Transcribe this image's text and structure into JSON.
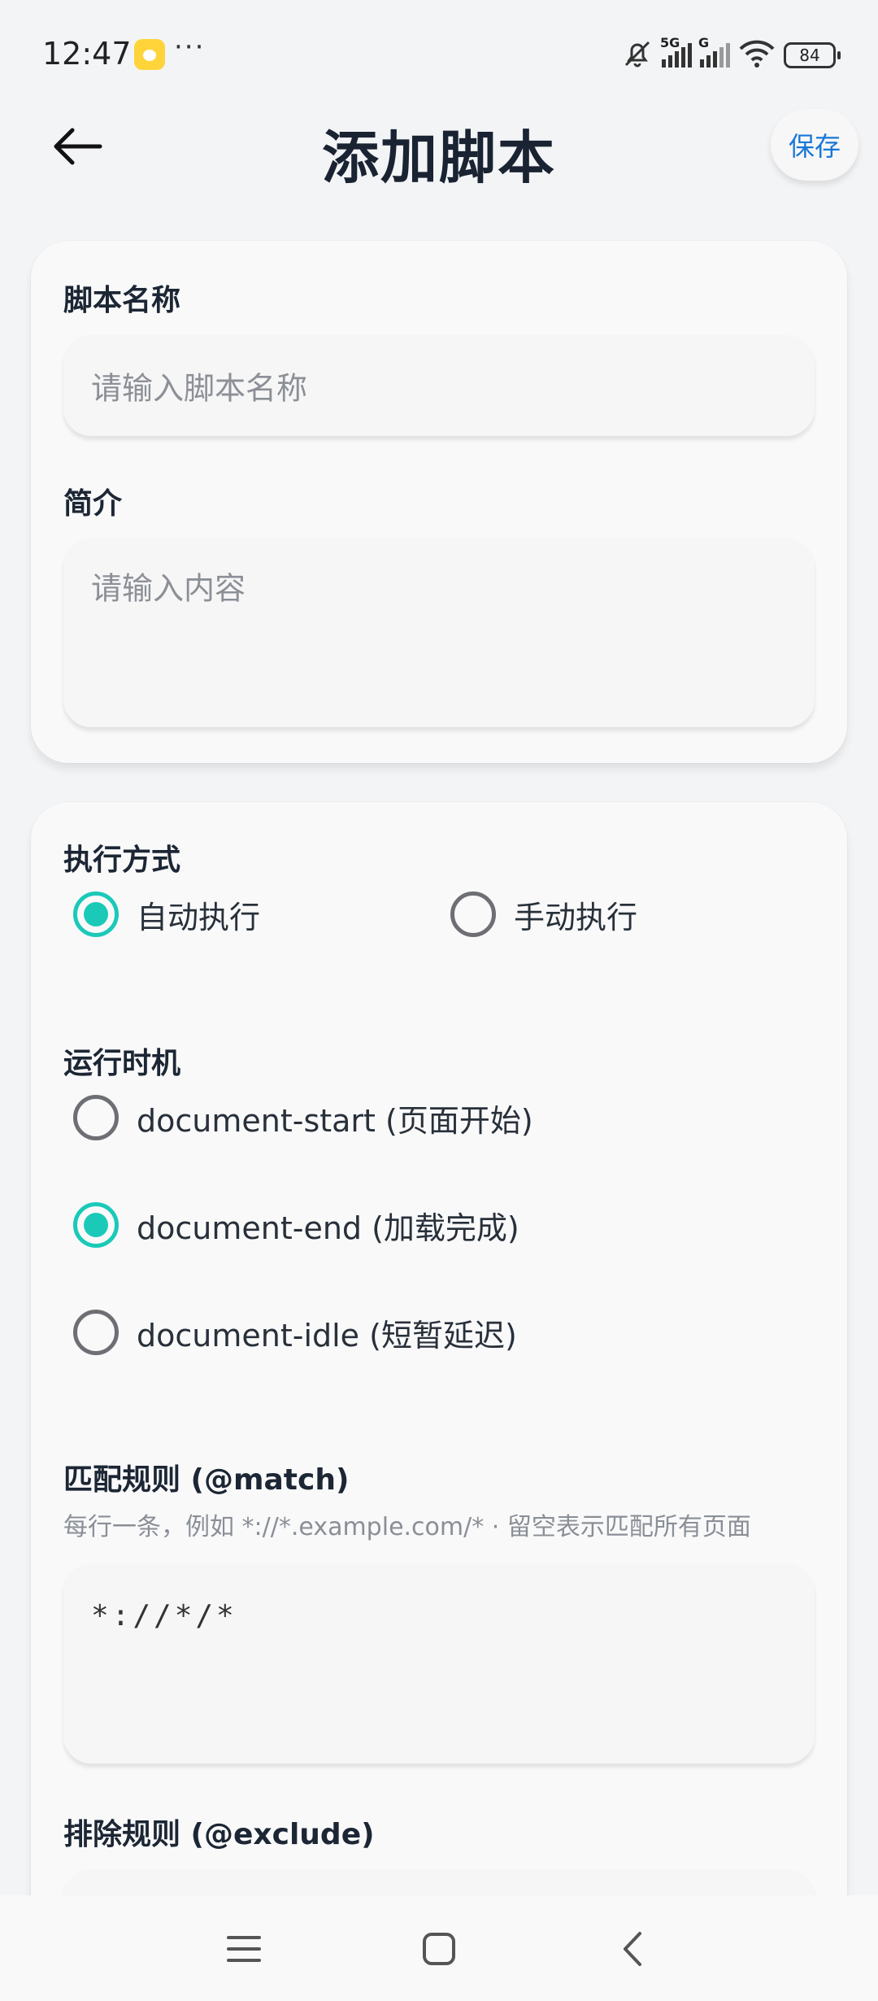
{
  "status_bar": {
    "time": "12:47",
    "more": "···",
    "signal1_label": "5G",
    "signal2_label": "G",
    "battery": "84",
    "icons": [
      "app-notification-icon",
      "mute-bell-icon",
      "signal-icon",
      "wifi-icon",
      "battery-icon"
    ]
  },
  "header": {
    "title": "添加脚本",
    "save_label": "保存",
    "back_icon": "arrow-left-icon"
  },
  "basic_info": {
    "name_label": "脚本名称",
    "name_placeholder": "请输入脚本名称",
    "name_value": "",
    "desc_label": "简介",
    "desc_placeholder": "请输入内容",
    "desc_value": ""
  },
  "execution": {
    "label": "执行方式",
    "options": [
      {
        "label": "自动执行",
        "selected": true
      },
      {
        "label": "手动执行",
        "selected": false
      }
    ]
  },
  "run_at": {
    "label": "运行时机",
    "options": [
      {
        "label": "document-start (页面开始)",
        "selected": false
      },
      {
        "label": "document-end (加载完成)",
        "selected": true
      },
      {
        "label": "document-idle (短暂延迟)",
        "selected": false
      }
    ]
  },
  "match": {
    "label": "匹配规则 (@match)",
    "hint": "每行一条，例如 *://*.example.com/*  ·  留空表示匹配所有页面",
    "value": "*://*/*"
  },
  "exclude": {
    "label": "排除规则 (@exclude)"
  },
  "nav_bar": {
    "icons": [
      "menu-icon",
      "home-icon",
      "back-icon"
    ]
  },
  "colors": {
    "accent": "#1bc9b8",
    "save_text": "#1877d6",
    "title": "#1a2332"
  }
}
